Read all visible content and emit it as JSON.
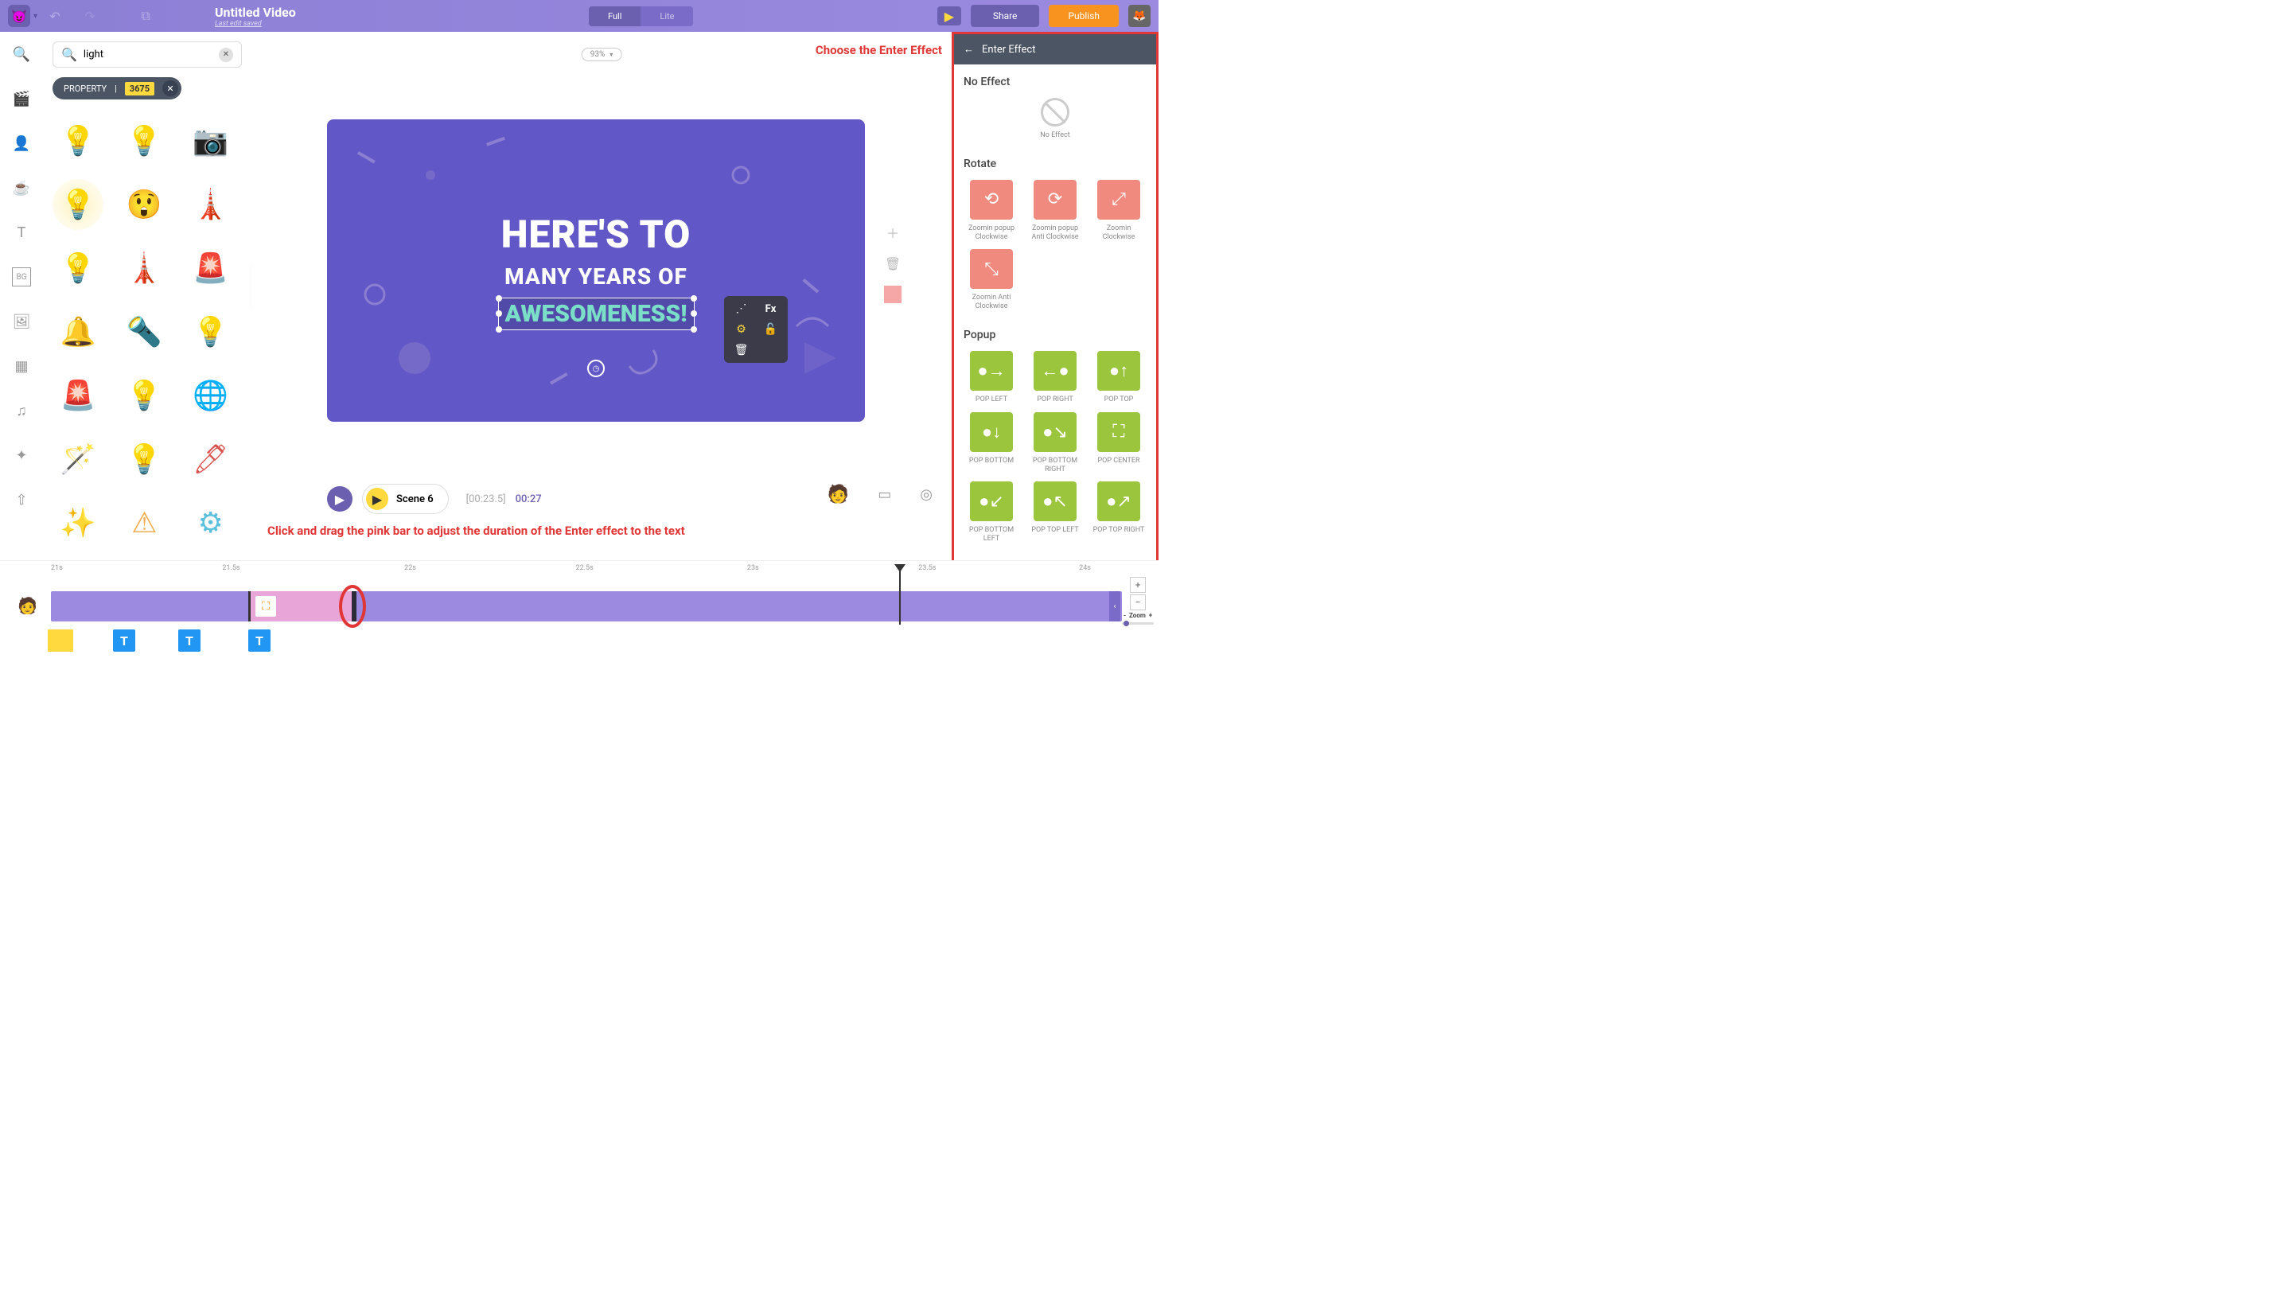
{
  "topbar": {
    "title": "Untitled Video",
    "subtitle": "Last edit saved",
    "mode_full": "Full",
    "mode_lite": "Lite",
    "share": "Share",
    "publish": "Publish"
  },
  "library": {
    "search_value": "light",
    "property_label": "PROPERTY",
    "property_count": "3675",
    "items": [
      "bulb-outline",
      "bulb-yellow",
      "studio-light",
      "bulb-glow",
      "bulb-face",
      "lighthouse-red",
      "bulb-orange",
      "lighthouse-stripe",
      "siren",
      "pendant-lamp",
      "flashlight",
      "bulb-warm",
      "alarm-light",
      "bulb-bright",
      "disco-ball",
      "wand",
      "bulb-big",
      "matchstick",
      "chandelier",
      "traffic-sign",
      "light-control"
    ]
  },
  "canvas": {
    "zoom": "93%",
    "line1": "HERE'S TO",
    "line2": "MANY YEARS OF",
    "line3": "AWESOMENESS!",
    "context_fx": "Fx"
  },
  "playback": {
    "scene_label": "Scene 6",
    "elapsed": "[00:23.5]",
    "total": "00:27"
  },
  "annotations": {
    "top": "Choose the Enter Effect",
    "bottom": "Click and drag the pink bar to adjust the duration of the Enter effect to the text"
  },
  "effects": {
    "header": "Enter Effect",
    "no_effect_title": "No Effect",
    "no_effect_label": "No Effect",
    "rotate_title": "Rotate",
    "rotate_items": [
      "Zoomin popup Clockwise",
      "Zoomin popup Anti Clockwise",
      "Zoomin Clockwise",
      "Zoomin Anti Clockwise"
    ],
    "popup_title": "Popup",
    "popup_items": [
      "POP LEFT",
      "POP RIGHT",
      "POP TOP",
      "POP BOTTOM",
      "POP BOTTOM RIGHT",
      "POP CENTER",
      "POP BOTTOM LEFT",
      "POP TOP LEFT",
      "POP TOP RIGHT"
    ]
  },
  "timeline": {
    "marks": [
      "21s",
      "21.5s",
      "22s",
      "22.5s",
      "23s",
      "23.5s",
      "24s"
    ],
    "zoom_label": "Zoom",
    "zoom_minus": "-",
    "zoom_plus": "+",
    "t_chips": [
      "T",
      "T",
      "T"
    ]
  }
}
